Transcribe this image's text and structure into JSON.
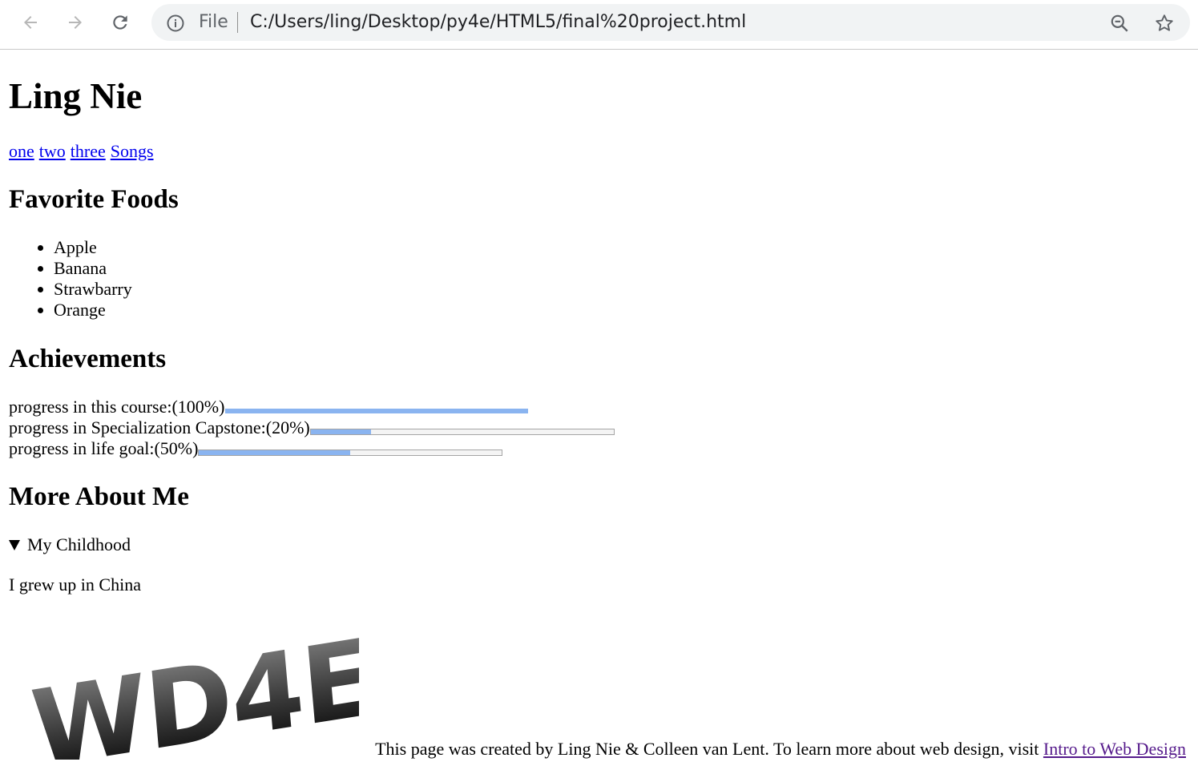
{
  "browser": {
    "file_label": "File",
    "url": "C:/Users/ling/Desktop/py4e/HTML5/final%20project.html"
  },
  "page": {
    "name": "Ling Nie",
    "nav_links": [
      "one",
      "two",
      "three",
      "Songs"
    ],
    "foods_heading": "Favorite Foods",
    "foods": [
      "Apple",
      "Banana",
      "Strawbarry",
      "Orange"
    ],
    "achievements_heading": "Achievements",
    "achievements": [
      {
        "label": "progress in this course:(100%)",
        "value": 1.0
      },
      {
        "label": "progress in Specialization Capstone:(20%)",
        "value": 0.2
      },
      {
        "label": "progress in life goal:(50%)",
        "value": 0.5
      }
    ],
    "more_heading": "More About Me",
    "details_summary": "My Childhood",
    "details_text": "I grew up in China",
    "logo_text": "WD4E",
    "footer_text": "This page was created by Ling Nie & Colleen van Lent. To learn more about web design, visit ",
    "footer_link": "Intro to Web Design"
  },
  "colors": {
    "link": "#0000ee",
    "visited_link": "#551a8b",
    "progress_fill": "#8ab4f0"
  }
}
